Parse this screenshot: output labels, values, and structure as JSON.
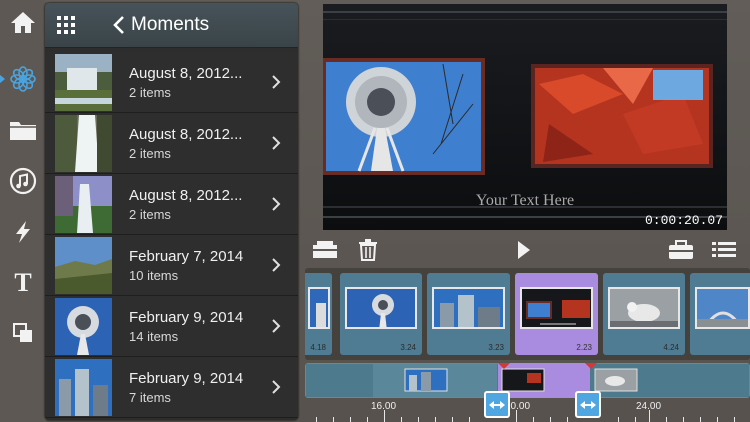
{
  "rail": {
    "items": [
      "home-icon",
      "photos-icon",
      "folder-icon",
      "music-icon",
      "lightning-icon",
      "title-text-icon",
      "layers-icon"
    ],
    "title_glyph": "T",
    "selected": "photos-icon",
    "accent": "#4aa3df"
  },
  "panel": {
    "back_label": "Moments",
    "rows": [
      {
        "title": "August 8, 2012...",
        "count": "2 items"
      },
      {
        "title": "August 8, 2012...",
        "count": "2 items"
      },
      {
        "title": "August 8, 2012...",
        "count": "2 items"
      },
      {
        "title": "February 7, 2014",
        "count": "10 items"
      },
      {
        "title": "February 9, 2014",
        "count": "14 items"
      },
      {
        "title": "February 9, 2014",
        "count": "7 items"
      }
    ]
  },
  "preview": {
    "overlay_text": "Your Text Here",
    "timecode": "0:00:20.07"
  },
  "toolbar": {
    "items": [
      "split-icon",
      "trash-icon",
      "play-icon",
      "toolbox-icon",
      "list-icon"
    ]
  },
  "storyboard": {
    "clips": [
      {
        "duration": "4.18"
      },
      {
        "duration": "3.24"
      },
      {
        "duration": "3.23"
      },
      {
        "duration": "2.23",
        "selected": true
      },
      {
        "duration": "4.24"
      },
      {
        "duration": ""
      }
    ],
    "selection_color": "#a98be0",
    "clip_color": "#4f7c92"
  },
  "timeline": {
    "ruler_labels": [
      "16.00",
      "20.00",
      "24.00"
    ],
    "handle_color": "#4fa6e0"
  }
}
